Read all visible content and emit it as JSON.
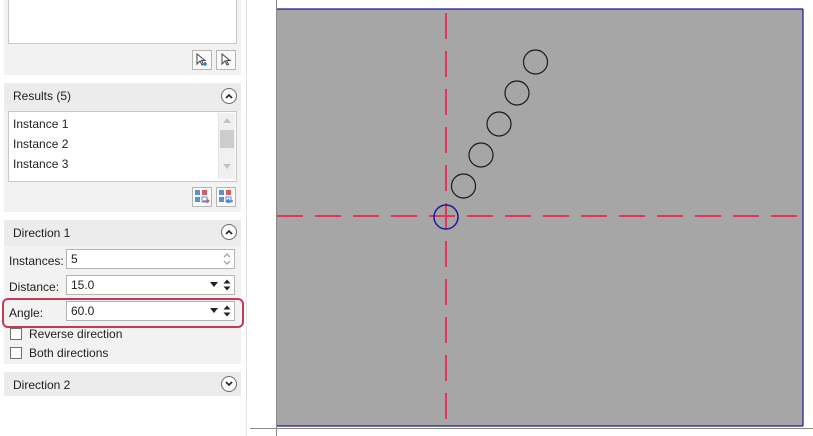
{
  "results": {
    "title": "Results (5)",
    "items": [
      "Instance 1",
      "Instance 2",
      "Instance 3"
    ]
  },
  "direction1": {
    "title": "Direction 1",
    "instances_label": "Instances:",
    "instances_value": "5",
    "distance_label": "Distance:",
    "distance_value": "15.0",
    "angle_label": "Angle:",
    "angle_value": "60.0",
    "reverse_label": "Reverse direction",
    "reverse_checked": false,
    "both_label": "Both directions",
    "both_checked": false
  },
  "direction2": {
    "title": "Direction 2"
  },
  "colors": {
    "canvas_bg": "#a6a6a6",
    "axis": "#e8335a",
    "frame": "#1c1c8c",
    "highlight": "#c8365a",
    "selected_circle": "#1c1c9c"
  }
}
